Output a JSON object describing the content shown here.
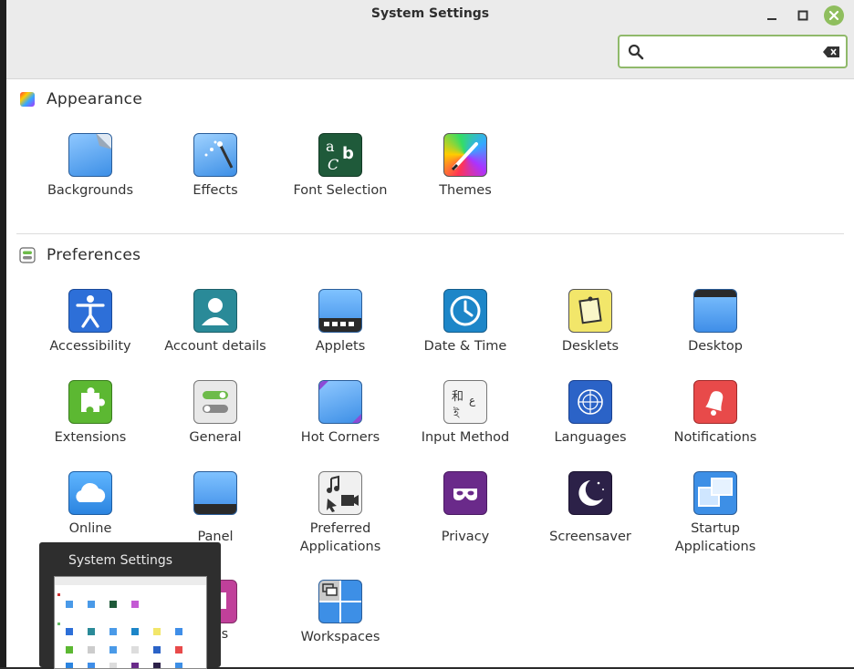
{
  "window": {
    "title": "System Settings"
  },
  "search": {
    "placeholder": "",
    "value": ""
  },
  "sections": {
    "appearance": {
      "title": "Appearance"
    },
    "preferences": {
      "title": "Preferences"
    }
  },
  "items": {
    "backgrounds": "Backgrounds",
    "effects": "Effects",
    "font_selection": "Font Selection",
    "themes": "Themes",
    "accessibility": "Accessibility",
    "account_details": "Account details",
    "applets": "Applets",
    "date_time": "Date & Time",
    "desklets": "Desklets",
    "desktop": "Desktop",
    "extensions": "Extensions",
    "general": "General",
    "hot_corners": "Hot Corners",
    "input_method": "Input Method",
    "languages": "Languages",
    "notifications": "Notifications",
    "online": "Online",
    "panel": "Panel",
    "preferred_applications_1": "Preferred",
    "preferred_applications_2": "Applications",
    "privacy": "Privacy",
    "screensaver": "Screensaver",
    "startup_applications_1": "Startup",
    "startup_applications_2": "Applications",
    "windows_partial": "ows",
    "workspaces": "Workspaces"
  },
  "taskbar_preview": {
    "title": "System Settings"
  },
  "colors": {
    "accent": "#8fbe5e",
    "search_border": "#8fb96a",
    "headerbar": "#ebebeb"
  }
}
